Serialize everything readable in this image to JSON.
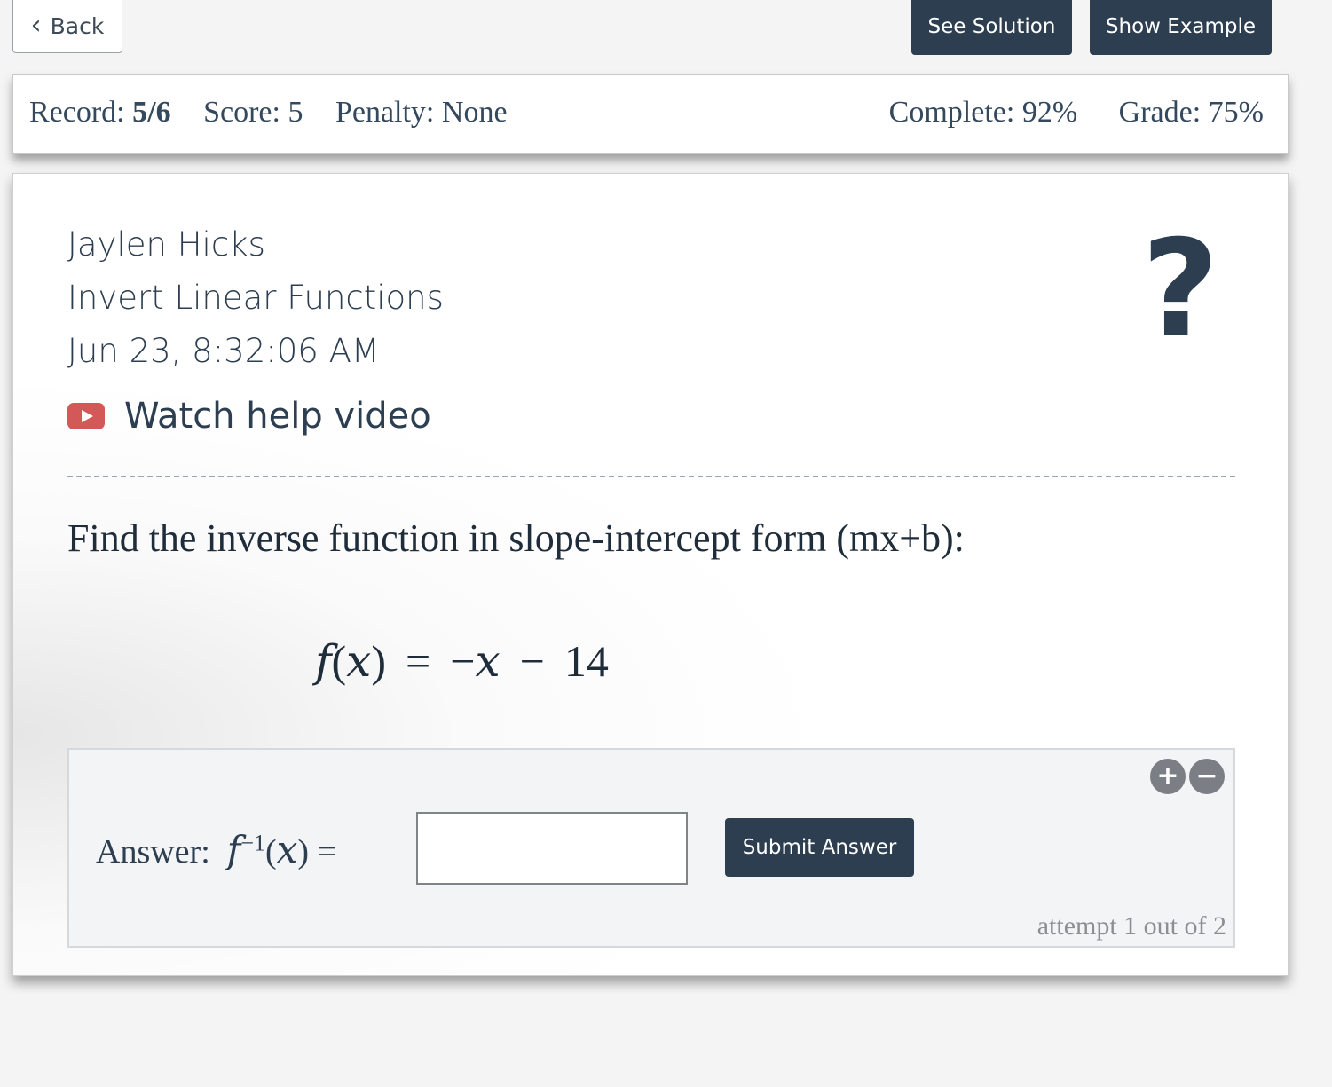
{
  "toolbar": {
    "back_label": "Back",
    "see_solution_label": "See Solution",
    "show_example_label": "Show Example"
  },
  "record_bar": {
    "record_label": "Record:",
    "record_value": "5/6",
    "score_label": "Score:",
    "score_value": "5",
    "penalty_label": "Penalty:",
    "penalty_value": "None",
    "complete_label": "Complete:",
    "complete_value": "92%",
    "grade_label": "Grade:",
    "grade_value": "75%"
  },
  "assignment": {
    "student_name": "Jaylen Hicks",
    "topic": "Invert Linear Functions",
    "timestamp": "Jun 23, 8:32:06 AM",
    "help_video_label": "Watch help video",
    "help_icon": "question-mark-icon",
    "video_icon": "youtube-play-icon"
  },
  "question": {
    "prompt": "Find the inverse function in slope-intercept form (mx+b):",
    "eq_f": "f",
    "eq_open": "(",
    "eq_x": "x",
    "eq_close": ")",
    "eq_equals": "=",
    "eq_neg": "−",
    "eq_x2": "x",
    "eq_minus": "−",
    "eq_const": "14"
  },
  "answer": {
    "label": "Answer:",
    "fn_f": "f",
    "fn_sup": "−1",
    "fn_open": "(",
    "fn_x": "x",
    "fn_close": ")",
    "fn_equals": "=",
    "input_value": "",
    "submit_label": "Submit Answer",
    "zoom_in_symbol": "+",
    "zoom_out_symbol": "−",
    "attempt_text": "attempt 1 out of 2"
  },
  "colors": {
    "primary_dark": "#2c3e50",
    "youtube_red": "#d35959",
    "zoom_gray": "#7b7f85"
  }
}
